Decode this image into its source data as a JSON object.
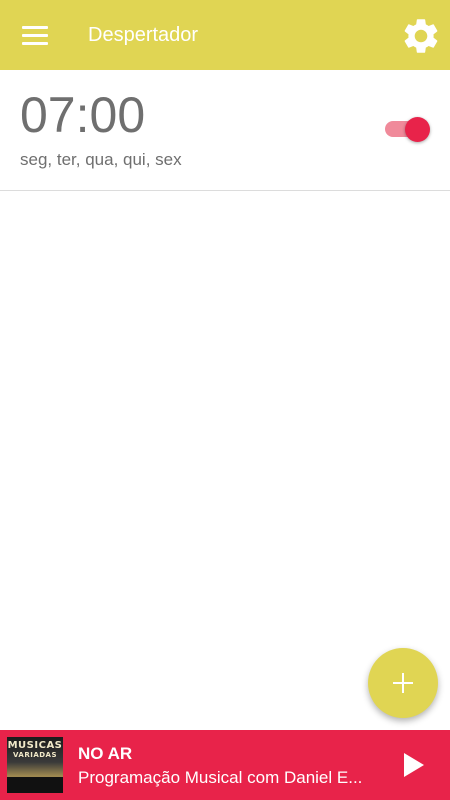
{
  "appbar": {
    "title": "Despertador",
    "menu_icon": "hamburger-menu-icon",
    "settings_icon": "gear-icon",
    "color": "#e0d553"
  },
  "alarms": [
    {
      "time": "07:00",
      "days": "seg, ter, qua, qui, sex",
      "enabled": true
    }
  ],
  "fab": {
    "icon": "plus-icon"
  },
  "player": {
    "status": "NO AR",
    "track": "Programação Musical com Daniel E...",
    "cover_text_1": "MUSICAS",
    "cover_text_2": "VARIADAS",
    "play_icon": "play-icon",
    "color": "#e8234a"
  },
  "colors": {
    "accent": "#e0d553",
    "toggle_on": "#e8234a",
    "toggle_track": "#f08a9a",
    "text_gray": "#6f6f6f"
  }
}
